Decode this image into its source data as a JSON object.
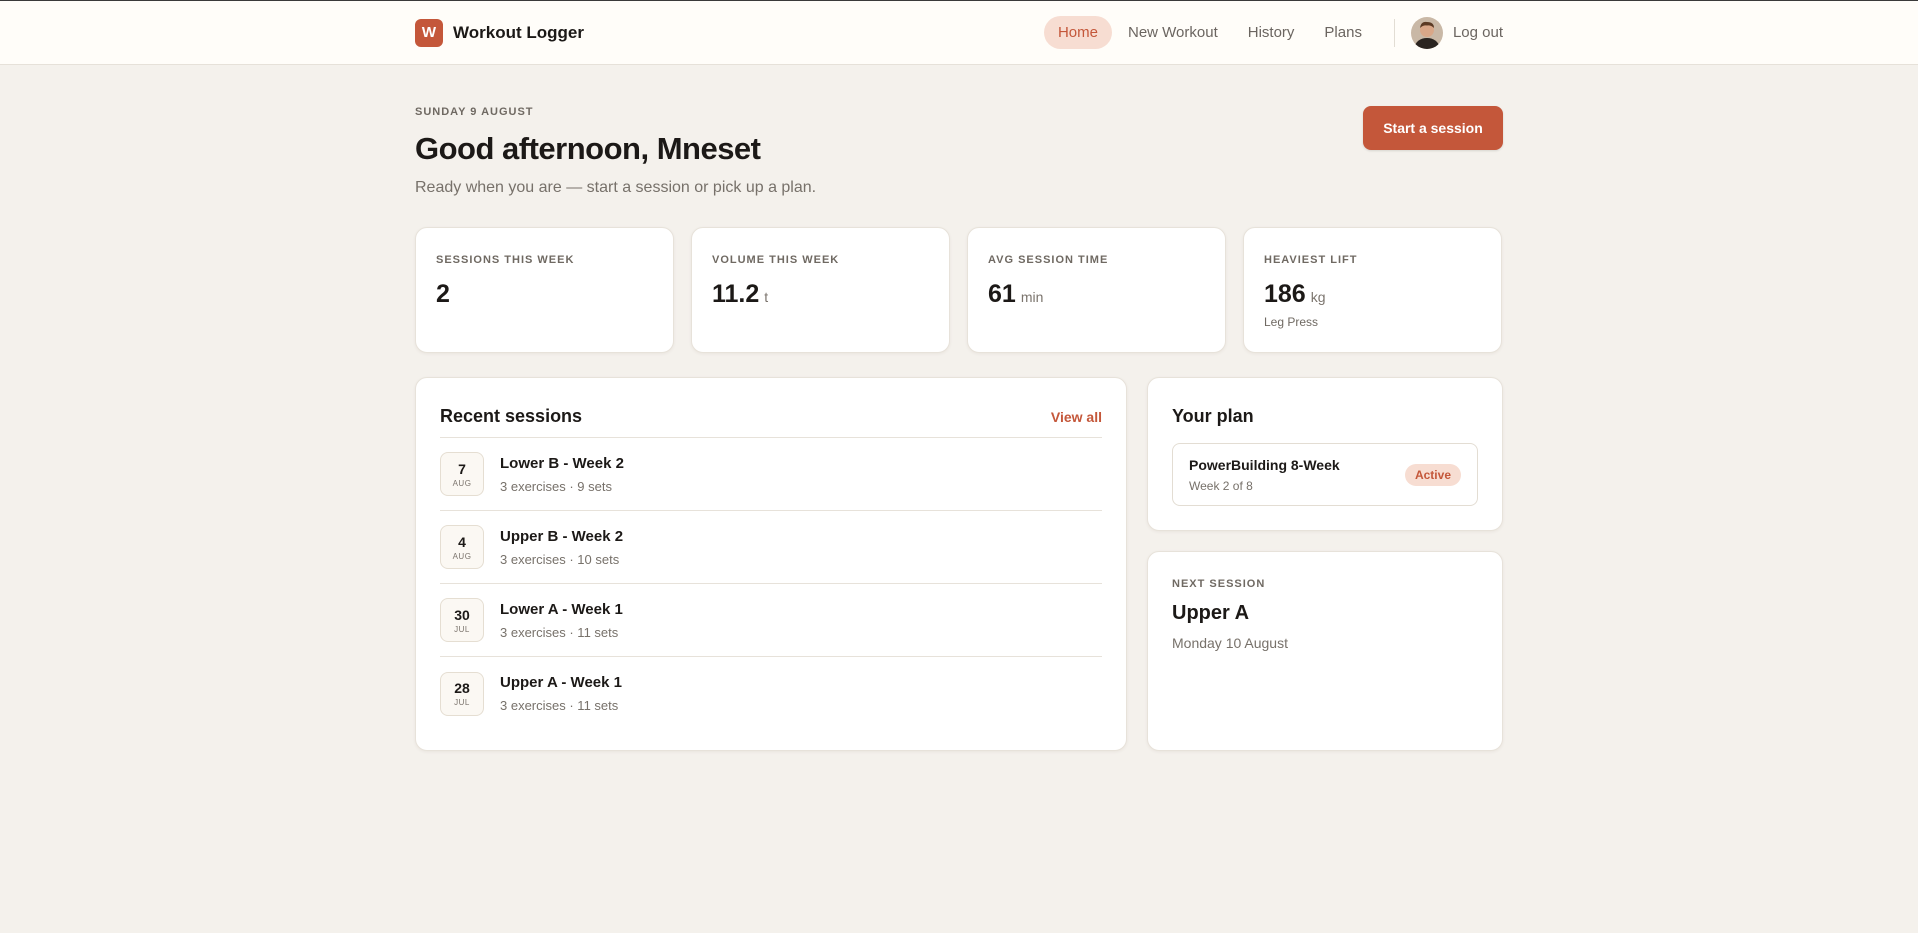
{
  "brand": {
    "logo_letter": "W",
    "name": "Workout Logger"
  },
  "nav": {
    "items": [
      {
        "label": "Home",
        "active": true
      },
      {
        "label": "New Workout",
        "active": false
      },
      {
        "label": "History",
        "active": false
      },
      {
        "label": "Plans",
        "active": false
      }
    ],
    "logout_label": "Log out"
  },
  "header": {
    "date": "SUNDAY 9 AUGUST",
    "greeting": "Good afternoon, Mneset",
    "subline": "Ready when you are — start a session or pick up a plan.",
    "start_button": "Start a session"
  },
  "stats": [
    {
      "label": "SESSIONS THIS WEEK",
      "value": "2",
      "unit": "",
      "sub": ""
    },
    {
      "label": "VOLUME THIS WEEK",
      "value": "11.2",
      "unit": "t",
      "sub": ""
    },
    {
      "label": "AVG SESSION TIME",
      "value": "61",
      "unit": "min",
      "sub": ""
    },
    {
      "label": "HEAVIEST LIFT",
      "value": "186",
      "unit": "kg",
      "sub": "Leg Press"
    }
  ],
  "recent": {
    "title": "Recent sessions",
    "view_all": "View all",
    "sessions": [
      {
        "day": "7",
        "month": "AUG",
        "name": "Lower B - Week 2",
        "meta": "3 exercises · 9 sets"
      },
      {
        "day": "4",
        "month": "AUG",
        "name": "Upper B - Week 2",
        "meta": "3 exercises · 10 sets"
      },
      {
        "day": "30",
        "month": "JUL",
        "name": "Lower A - Week 1",
        "meta": "3 exercises · 11 sets"
      },
      {
        "day": "28",
        "month": "JUL",
        "name": "Upper A - Week 1",
        "meta": "3 exercises · 11 sets"
      }
    ]
  },
  "plan": {
    "title": "Your plan",
    "name": "PowerBuilding 8-Week",
    "week": "Week 2 of 8",
    "badge": "Active"
  },
  "next_session": {
    "label": "NEXT SESSION",
    "name": "Upper A",
    "date": "Monday 10 August"
  },
  "colors": {
    "accent": "#c4573a",
    "accent_soft": "#f7ddd2",
    "background": "#f4f1ec"
  }
}
